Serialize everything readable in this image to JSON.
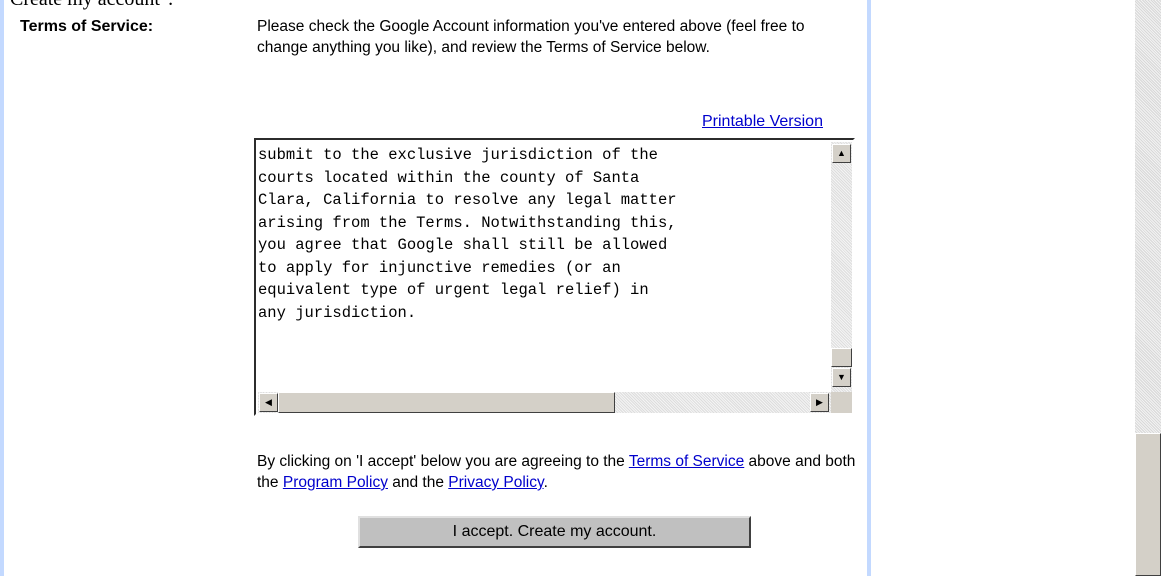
{
  "heading_partial": ". Create my account\".",
  "section": {
    "label": "Terms of Service:"
  },
  "intro": "Please check the Google Account information you've entered above (feel free to change anything you like), and review the Terms of Service below.",
  "printable_link": "Printable Version",
  "terms_text": "submit to the exclusive jurisdiction of the\ncourts located within the county of Santa\nClara, California to resolve any legal matter\narising from the Terms. Notwithstanding this,\nyou agree that Google shall still be allowed\nto apply for injunctive remedies (or an\nequivalent type of urgent legal relief) in\nany jurisdiction.",
  "agreement": {
    "prefix": "By clicking on 'I accept' below you are agreeing to the ",
    "tos_link": "Terms of Service",
    "middle": " above and both the ",
    "program_link": "Program Policy",
    "and": " and the ",
    "privacy_link": "Privacy Policy",
    "suffix": "."
  },
  "accept_button": "I accept. Create my account.",
  "icons": {
    "scroll_up": "▲",
    "scroll_down": "▼",
    "scroll_left": "◀",
    "scroll_right": "▶"
  },
  "colors": {
    "link": "#0000cc",
    "border_accent": "#c3d9ff",
    "button": "#c0c0c0"
  }
}
